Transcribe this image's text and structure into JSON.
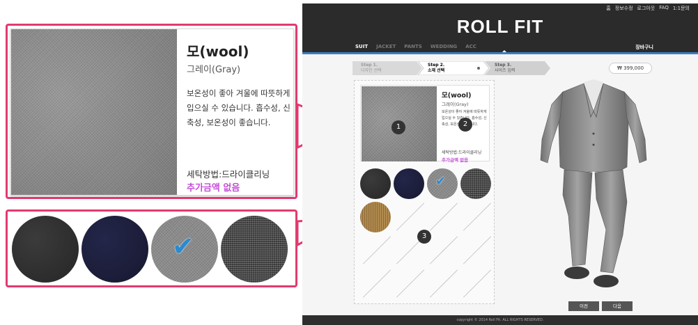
{
  "callout": {
    "title": "모(wool)",
    "subtitle": "그레이(Gray)",
    "description": "보온성이 좋아 겨울에 따뜻하게 입으실 수 있습니다. 흡수성, 신축성, 보온성이 좋습니다.",
    "wash": "세탁방법:드라이클리닝",
    "price": "추가금액 없음",
    "check": "✔"
  },
  "header": {
    "util_links": [
      "홈",
      "정보수정",
      "로그아웃",
      "FAQ",
      "1:1문의"
    ],
    "logo": "ROLL FIT",
    "nav": [
      "SUIT",
      "JACKET",
      "PANTS",
      "WEDDING",
      "ACC"
    ],
    "cart": "장바구니"
  },
  "steps": [
    {
      "label": "Step 1.",
      "name": "디자인 선택"
    },
    {
      "label": "Step 2.",
      "name": "소재 선택"
    },
    {
      "label": "Step 3.",
      "name": "사이즈 입력"
    }
  ],
  "price": "₩ 399,000",
  "markers": [
    "1",
    "2",
    "3"
  ],
  "buttons": {
    "prev": "이전",
    "next": "다음"
  },
  "footer": "copyright © 2014 Roll Fit. ALL RIGHTS RESERVED.",
  "colors": {
    "accent_pink": "#e23a6e",
    "price_purple": "#c44dd8",
    "nav_blue": "#3a7fc1",
    "check_blue": "#2a8ad0"
  }
}
